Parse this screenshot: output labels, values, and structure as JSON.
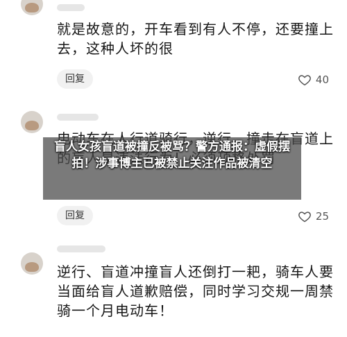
{
  "comments": [
    {
      "text": "就是故意的，开车看到有人不停，还要撞上去，这种人坏的很",
      "reply_label": "回复",
      "likes": "40"
    },
    {
      "text": "电动车在人行道骑行，逆行，撞走在盲道上的盲人是违法行为！必须顶格处罚",
      "reply_label": "回复",
      "likes": "25"
    },
    {
      "text": "逆行、盲道冲撞盲人还倒打一耙，骑车人要当面给盲人道歉赔偿，同时学习交规一周禁骑一个月电动车！"
    }
  ],
  "overlay": {
    "headline": "盲人女孩盲道被撞反被骂？警方通报：虚假摆拍！涉事博主已被禁止关注作品被清空"
  }
}
